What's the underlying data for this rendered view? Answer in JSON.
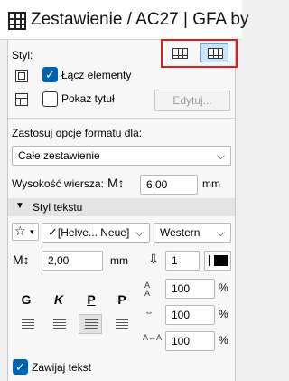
{
  "window": {
    "title": "Zestawienie / AC27 | GFA by"
  },
  "style": {
    "label": "Styl:",
    "merge_elements": {
      "label": "Łącz elementy",
      "checked": true
    },
    "show_title": {
      "label": "Pokaż tytuł",
      "checked": false
    },
    "edit_button": "Edytuj..."
  },
  "format_options": {
    "label": "Zastosuj opcje formatu dla:",
    "selected": "Całe zestawienie"
  },
  "row_height": {
    "label": "Wysokość wiersza:",
    "value": "6,00",
    "unit": "mm"
  },
  "text_style": {
    "section_label": "Styl tekstu",
    "font": "[Helve... Neue]",
    "script": "Western",
    "size": "2,00",
    "size_unit": "mm",
    "pen": "1",
    "format_letters": [
      "G",
      "K",
      "P",
      "P"
    ],
    "spacing": [
      {
        "value": "100",
        "unit": "%"
      },
      {
        "value": "100",
        "unit": "%"
      },
      {
        "value": "100",
        "unit": "%"
      }
    ],
    "wrap_text": {
      "label": "Zawijaj tekst",
      "checked": true
    }
  }
}
